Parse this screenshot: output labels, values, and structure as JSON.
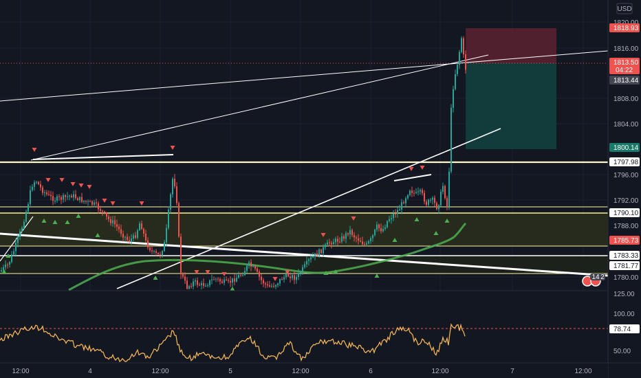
{
  "currency": "USD",
  "price_axis": {
    "ticks": [
      "1820.00",
      "1816.00",
      "1808.00",
      "1804.00",
      "1796.00",
      "1792.00",
      "1788.00",
      "1780.00"
    ],
    "tags": [
      {
        "label": "1818.93",
        "bg": "#ef5350",
        "fg": "#ffffff"
      },
      {
        "label": "1813.50",
        "bg": "#ef5350",
        "fg": "#ffffff",
        "sub": "04:22"
      },
      {
        "label": "1813.44",
        "bg": "#434651",
        "fg": "#ffffff"
      },
      {
        "label": "1800.14",
        "bg": "#1a7a6a",
        "fg": "#ffffff"
      },
      {
        "label": "1797.98",
        "bg": "#ffffff",
        "fg": "#131722"
      },
      {
        "label": "1790.10",
        "bg": "#ffffff",
        "fg": "#131722"
      },
      {
        "label": "1785.73",
        "bg": "#ef5350",
        "fg": "#ffffff"
      },
      {
        "label": "1783.33",
        "bg": "#ffffff",
        "fg": "#131722"
      },
      {
        "label": "1781.77",
        "bg": "#ffffff",
        "fg": "#131722"
      }
    ]
  },
  "indicator_axis": {
    "ticks": [
      "125.00",
      "100.00",
      "50.00"
    ],
    "tag": {
      "label": "78.74",
      "bg": "#ffffff",
      "fg": "#131722"
    }
  },
  "time_axis": [
    "12:00",
    "4",
    "12:00",
    "5",
    "12:00",
    "6",
    "12:00",
    "7",
    "12:00"
  ],
  "badge": {
    "count": "14",
    "second": "2"
  },
  "colors": {
    "bg": "#131722",
    "up": "#26a69a",
    "down": "#ef5350",
    "ma": "#4caf50",
    "osc": "#f0b357",
    "level": "#fff59d",
    "sl_zone": "#5d2230",
    "tp_zone": "#12433f"
  }
}
